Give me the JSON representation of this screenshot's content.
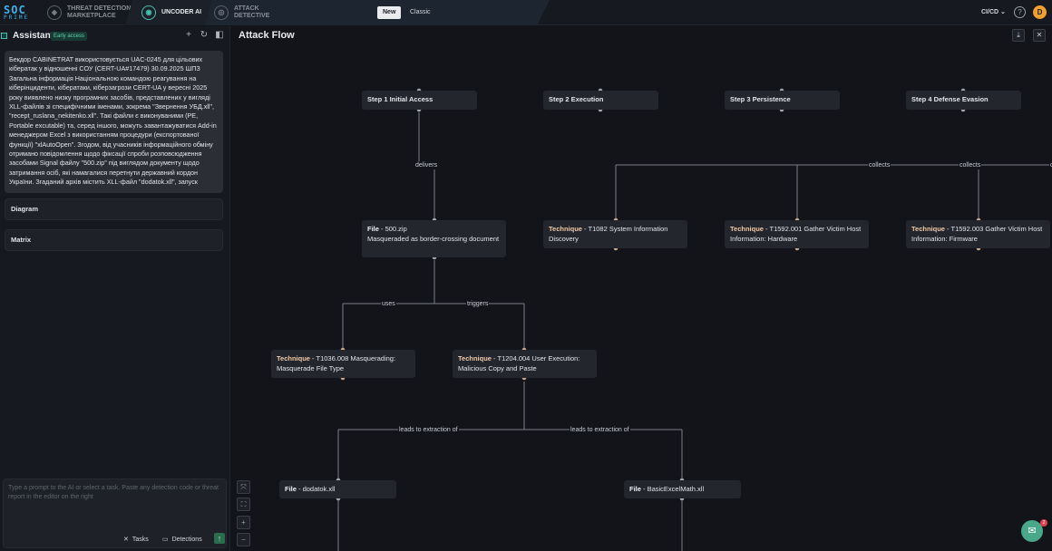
{
  "topbar": {
    "logo_line1": "SOC",
    "logo_line2": "PRIME",
    "nav": [
      {
        "line1": "THREAT DETECTION",
        "line2": "MARKETPLACE"
      },
      {
        "line1": "UNCODER AI",
        "line2": ""
      },
      {
        "line1": "ATTACK",
        "line2": "DETECTIVE"
      }
    ],
    "mode_new": "New",
    "mode_classic": "Classic",
    "cicd": "CI/CD",
    "help": "?",
    "avatar": "D"
  },
  "sidebar": {
    "title": "Assistant",
    "badge": "Early access",
    "message": "Бекдор CABINETRAT використовується UAC-0245 для цільових кібератак у відношенні СОУ (CERT-UA#17479) 30.09.2025 ШПЗ Загальна інформація Національною командою реагування на кіберінциденти, кібератаки, кіберзагрози CERT-UA у вересні 2025 року виявлено низку програмних засобів, представлених у вигляді XLL-файлів зі специфічними іменами, зокрема \"Звернення УБД.xll\", \"recept_ruslana_nekitenko.xll\". Такі файли є виконуваними (PE, Portable excutable) та, серед іншого, можуть завантажуватися Add-in менеджером Excel з використанням процедури (експортованої функції) \"xlAutoOpen\". Згодом, від учасників інформаційного обміну отримано повідомлення щодо фіксації спроби розповсюдження засобами Signal файлу \"500.zip\" під виглядом документу щодо затримання осіб, які намагалися перетнути державний кордон України. Згаданий архів містить XLL-файл \"dodatok.xll\", запуск",
    "diagram": "Diagram",
    "matrix": "Matrix",
    "prompt_placeholder": "Type a prompt to the AI or select a task. Paste any detection code or threat report in the editor on the right",
    "tasks": "Tasks",
    "detections": "Detections"
  },
  "main": {
    "title": "Attack Flow",
    "steps": [
      "Step 1 Initial Access",
      "Step 2 Execution",
      "Step 3 Persistence",
      "Step 4 Defense Evasion"
    ],
    "nodes": {
      "file500": {
        "kind": "File",
        "text": " - 500.zip",
        "desc": "Masqueraded as border-crossing document"
      },
      "t1082": {
        "kind": "Technique",
        "text": " - T1082 System Information Discovery"
      },
      "t1592_001": {
        "kind": "Technique",
        "text": " - T1592.001 Gather Victim Host Information: Hardware"
      },
      "t1592_003": {
        "kind": "Technique",
        "text": " - T1592.003 Gather Victim Host Information: Firmware"
      },
      "t1036": {
        "kind": "Technique",
        "text": " - T1036.008 Masquerading: Masquerade File Type"
      },
      "t1204": {
        "kind": "Technique",
        "text": " - T1204.004 User Execution: Malicious Copy and Paste"
      },
      "dodatok": {
        "kind": "File",
        "text": " - dodatok.xll"
      },
      "basic": {
        "kind": "File",
        "text": " - BasicExcelMath.xll"
      }
    },
    "edge_labels": {
      "delivers": "delivers",
      "collects1": "collects",
      "collects2": "collects",
      "collects3": "c",
      "uses": "uses",
      "triggers": "triggers",
      "leads1": "leads to extraction of",
      "leads2": "leads to extraction of"
    }
  }
}
